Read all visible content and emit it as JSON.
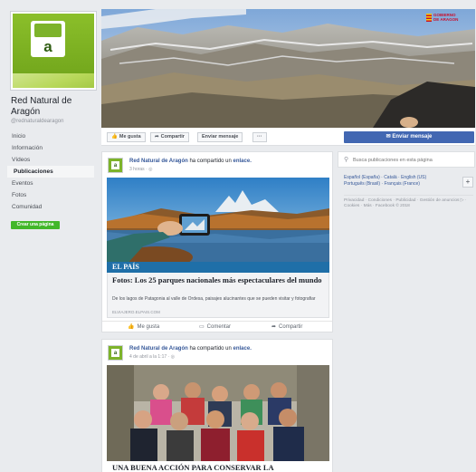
{
  "sidebar": {
    "page_name": "Red Natural de Aragón",
    "handle": "@rednaturaldearagon",
    "logo_letter": "a",
    "nav": [
      {
        "label": "Inicio",
        "active": false
      },
      {
        "label": "Información",
        "active": false
      },
      {
        "label": "Vídeos",
        "active": false
      },
      {
        "label": "Publicaciones",
        "active": true
      },
      {
        "label": "Eventos",
        "active": false
      },
      {
        "label": "Fotos",
        "active": false
      },
      {
        "label": "Comunidad",
        "active": false
      }
    ],
    "create_page_label": "Crear una página"
  },
  "cover": {
    "gov_logo_line1": "GOBIERNO",
    "gov_logo_line2": "DE ARAGON"
  },
  "actions": {
    "like_label": "Me gusta",
    "share_label": "Compartir",
    "message_label": "Enviar mensaje",
    "more_label": "···",
    "send_message_label": "Enviar mensaje"
  },
  "posts": [
    {
      "author": "Red Natural de Aragón",
      "verb": "ha compartido un",
      "object": "enlace.",
      "time": "3 horas",
      "source_brand": "EL PAÍS",
      "link_title": "Fotos: Los 25 parques nacionales más espectaculares del mundo",
      "link_desc": "De los lagos de Patagonia al valle de Ordesa, paisajes alucinantes que se pueden visitar y fotografiar",
      "link_domain": "ELVIAJERO.ELPAIS.COM",
      "like": "Me gusta",
      "comment": "Comentar",
      "share": "Compartir"
    },
    {
      "author": "Red Natural de Aragón",
      "verb": "ha compartido un",
      "object": "enlace.",
      "time": "4 de abril a la 1:17",
      "caption": "UNA BUENA ACCIÓN PARA CONSERVAR LA"
    }
  ],
  "right": {
    "search_placeholder": "Busca publicaciones en esta página",
    "lang_line1": "Español (España) · Català · English (US)",
    "lang_line2": "Português (Brasil) · Français (France)",
    "plus": "+",
    "footer": "Privacidad · Condiciones · Publicidad · Gestión de anuncios ▷ · Cookies · Más · Facebook © 2018"
  },
  "colors": {
    "brand_green": "#7db32a",
    "facebook_blue": "#4267b2",
    "link_blue": "#365899",
    "create_green": "#42b72a",
    "elpais_blue": "#1f6fa8"
  },
  "icons": {
    "like": "thumbs-up-icon",
    "share": "share-icon",
    "messenger": "messenger-icon",
    "search": "search-icon",
    "globe": "globe-icon",
    "comment": "comment-icon"
  }
}
